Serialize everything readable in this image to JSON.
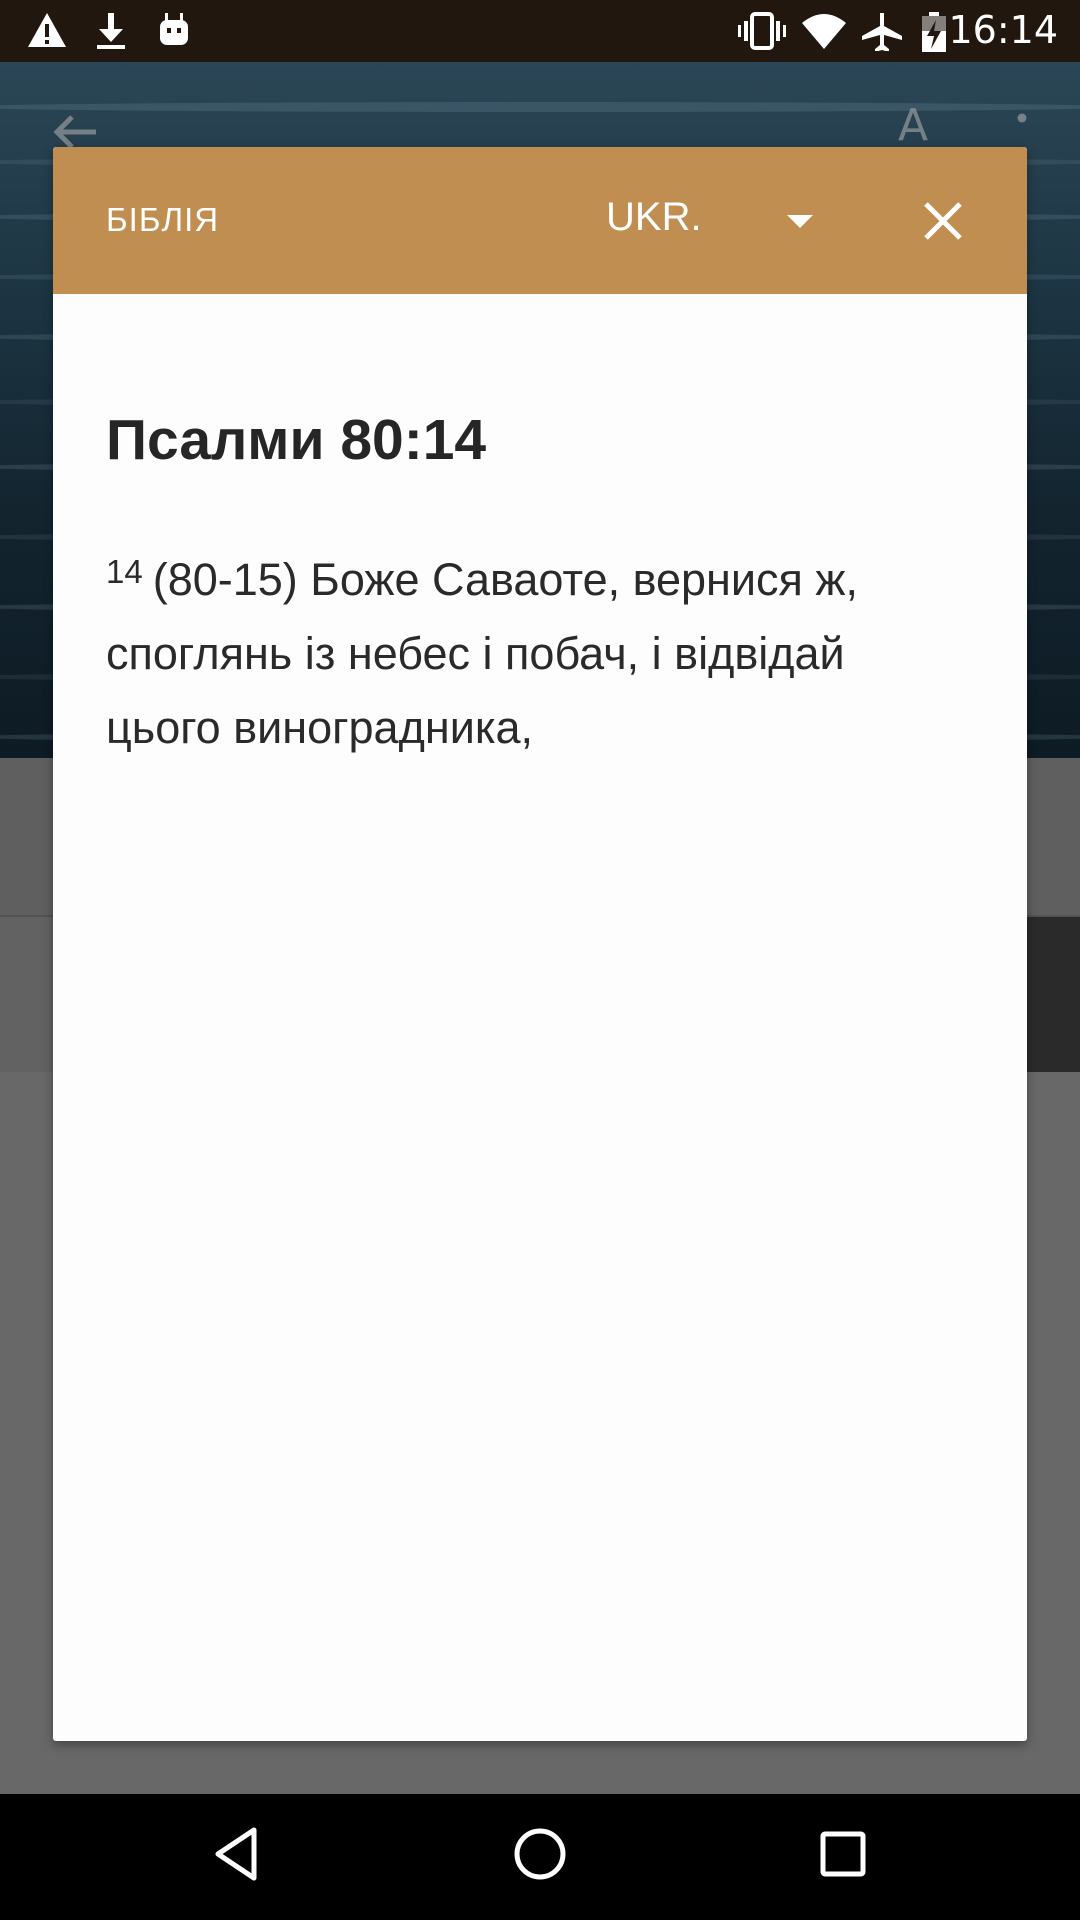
{
  "status_bar": {
    "time": "16:14",
    "left_icons": [
      "warning-icon",
      "download-icon",
      "android-icon"
    ],
    "right_icons": [
      "vibrate-icon",
      "wifi-icon",
      "airplane-mode-icon",
      "battery-charging-icon"
    ]
  },
  "background_app": {
    "font_button_label": "A"
  },
  "dialog": {
    "title": "БІБЛІЯ",
    "language": "UKR.",
    "reference": "Псалми 80:14",
    "verse_number": "14",
    "verse_text": "(80-15) Боже Саваоте, вернися ж, споглянь із небес і побач, і відвідай цього виноградника,"
  },
  "colors": {
    "dialog_header": "#c08e50",
    "status_bar": "#22170f",
    "scrim": "#646464"
  }
}
